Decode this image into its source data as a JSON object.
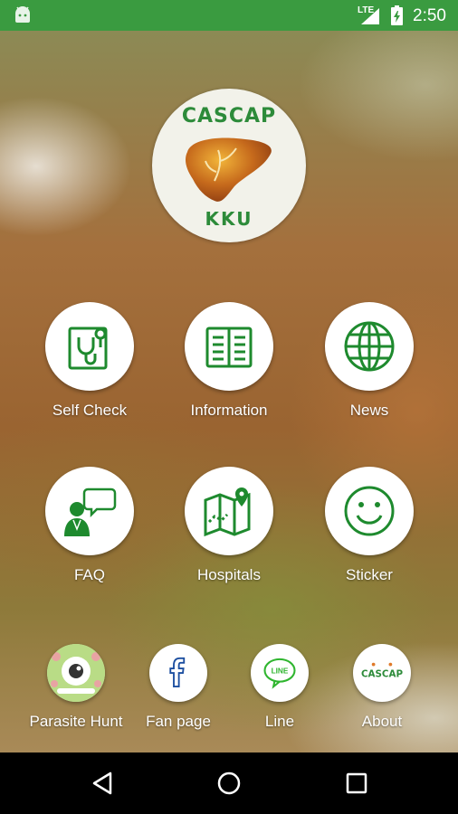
{
  "status_bar": {
    "network_type": "LTE",
    "time": "2:50",
    "color": "#3a9b40"
  },
  "logo": {
    "top_text": "CASCAP",
    "bottom_text": "KKU"
  },
  "menu": [
    {
      "label": "Self Check",
      "icon": "stethoscope-icon"
    },
    {
      "label": "Information",
      "icon": "book-icon"
    },
    {
      "label": "News",
      "icon": "globe-icon"
    },
    {
      "label": "FAQ",
      "icon": "doctor-chat-icon"
    },
    {
      "label": "Hospitals",
      "icon": "map-pin-icon"
    },
    {
      "label": "Sticker",
      "icon": "smiley-icon"
    }
  ],
  "bottom_links": [
    {
      "label": "Parasite Hunt",
      "icon": "parasite-eye-icon"
    },
    {
      "label": "Fan page",
      "icon": "facebook-icon"
    },
    {
      "label": "Line",
      "icon": "line-icon",
      "icon_text": "LINE"
    },
    {
      "label": "About",
      "icon": "cascap-logo-icon",
      "icon_text": "CASCAP"
    }
  ],
  "accent_color": "#1e8a2e",
  "nav_bar": {
    "back": "back-icon",
    "home": "home-icon",
    "recents": "recents-icon"
  }
}
